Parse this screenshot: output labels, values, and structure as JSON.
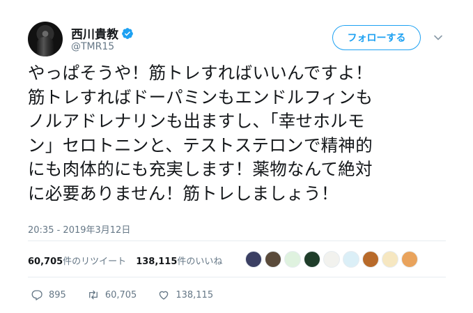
{
  "user": {
    "display_name": "西川貴教",
    "handle": "@TMR15"
  },
  "follow_button": {
    "label": "フォローする"
  },
  "tweet": {
    "lines": [
      "やっぱそうや！筋トレすればいいんですよ！",
      "筋トレすればドーパミンもエンドルフィンも",
      "ノルアドレナリンも出ますし、「幸せホルモ",
      "ン」セロトニンと、テストステロンで精神的",
      "にも肉体的にも充実します！薬物なんて絶対",
      "に必要ありません！筋トレしましょう！"
    ],
    "timestamp": "20:35 - 2019年3月12日"
  },
  "stats": {
    "retweets_count": "60,705",
    "retweets_label": "件のリツイート",
    "likes_count": "138,115",
    "likes_label": "件のいいね"
  },
  "likers": {
    "avatar_colors": [
      "#3b3f63",
      "#5a4a3a",
      "#dff2df",
      "#1f3d2a",
      "#f2f2ee",
      "#dbeff7",
      "#b86a2a",
      "#f6e7c1",
      "#e9a35c"
    ]
  },
  "actions": {
    "replies": "895",
    "retweets": "60,705",
    "likes": "138,115"
  },
  "colors": {
    "accent": "#1da1f2",
    "text": "#14171a",
    "muted": "#657786"
  }
}
